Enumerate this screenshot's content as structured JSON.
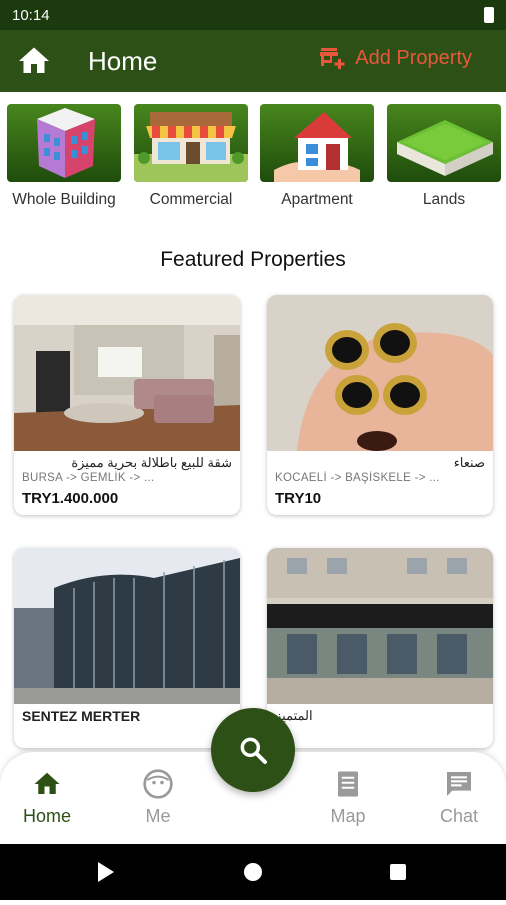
{
  "status_bar": {
    "time": "10:14"
  },
  "app_bar": {
    "title": "Home",
    "add_property_label": "Add Property"
  },
  "categories": [
    {
      "label": "Whole Building"
    },
    {
      "label": "Commercial"
    },
    {
      "label": "Apartment"
    },
    {
      "label": "Lands"
    }
  ],
  "featured": {
    "title": "Featured Properties",
    "cards": [
      {
        "title": "شقة للبيع باطلالة بحرية مميزة",
        "location": "BURSA -> GEMLİK -> ...",
        "price": "TRY1.400.000"
      },
      {
        "title": "صنعاء",
        "location": "KOCAELİ -> BAŞİSKELE -> ...",
        "price": "TRY10"
      },
      {
        "title": "SENTEZ MERTER",
        "location": "",
        "price": ""
      },
      {
        "title": "المتميز",
        "location": "",
        "price": ""
      }
    ]
  },
  "bottom_nav": {
    "items": [
      {
        "label": "Home",
        "icon": "home-icon"
      },
      {
        "label": "Me",
        "icon": "face-icon"
      },
      {
        "label": "Map",
        "icon": "map-icon"
      },
      {
        "label": "Chat",
        "icon": "chat-icon"
      }
    ],
    "fab_icon": "search-icon"
  },
  "colors": {
    "primary": "#2d5016",
    "accent": "#e8573c",
    "status_bar": "#1b3a0e"
  }
}
